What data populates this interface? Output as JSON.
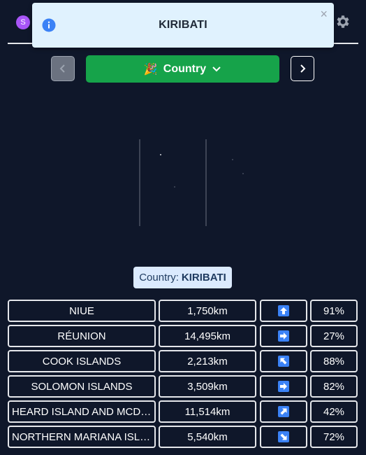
{
  "header": {
    "avatar_letter": "S",
    "settings_icon": "gear-icon"
  },
  "toast": {
    "icon": "info-icon",
    "title": "KIRIBATI",
    "close_label": "×"
  },
  "controls": {
    "prev_icon": "chevron-left-icon",
    "next_icon": "chevron-right-icon",
    "mode_emoji": "🎉",
    "mode_label": "Country",
    "mode_dropdown_icon": "chevron-down-icon"
  },
  "answer": {
    "prefix": "Country:",
    "name": "KIRIBATI"
  },
  "colors": {
    "background": "#0f172a",
    "accent_green": "#16a34a",
    "toast_bg": "#e0f2fe",
    "badge_bg": "#dbeafe",
    "arrow_blue": "#3b82f6"
  },
  "guesses": [
    {
      "name": "NIUE",
      "distance": "1,750km",
      "direction": "up",
      "percent": "91%"
    },
    {
      "name": "RÉUNION",
      "distance": "14,495km",
      "direction": "right",
      "percent": "27%"
    },
    {
      "name": "COOK ISLANDS",
      "distance": "2,213km",
      "direction": "up-left",
      "percent": "88%"
    },
    {
      "name": "SOLOMON ISLANDS",
      "distance": "3,509km",
      "direction": "right",
      "percent": "82%"
    },
    {
      "name": "HEARD ISLAND AND MCDONALD ISLANDS",
      "distance": "11,514km",
      "direction": "up-right",
      "percent": "42%"
    },
    {
      "name": "NORTHERN MARIANA ISLANDS",
      "distance": "5,540km",
      "direction": "down-right",
      "percent": "72%"
    }
  ]
}
